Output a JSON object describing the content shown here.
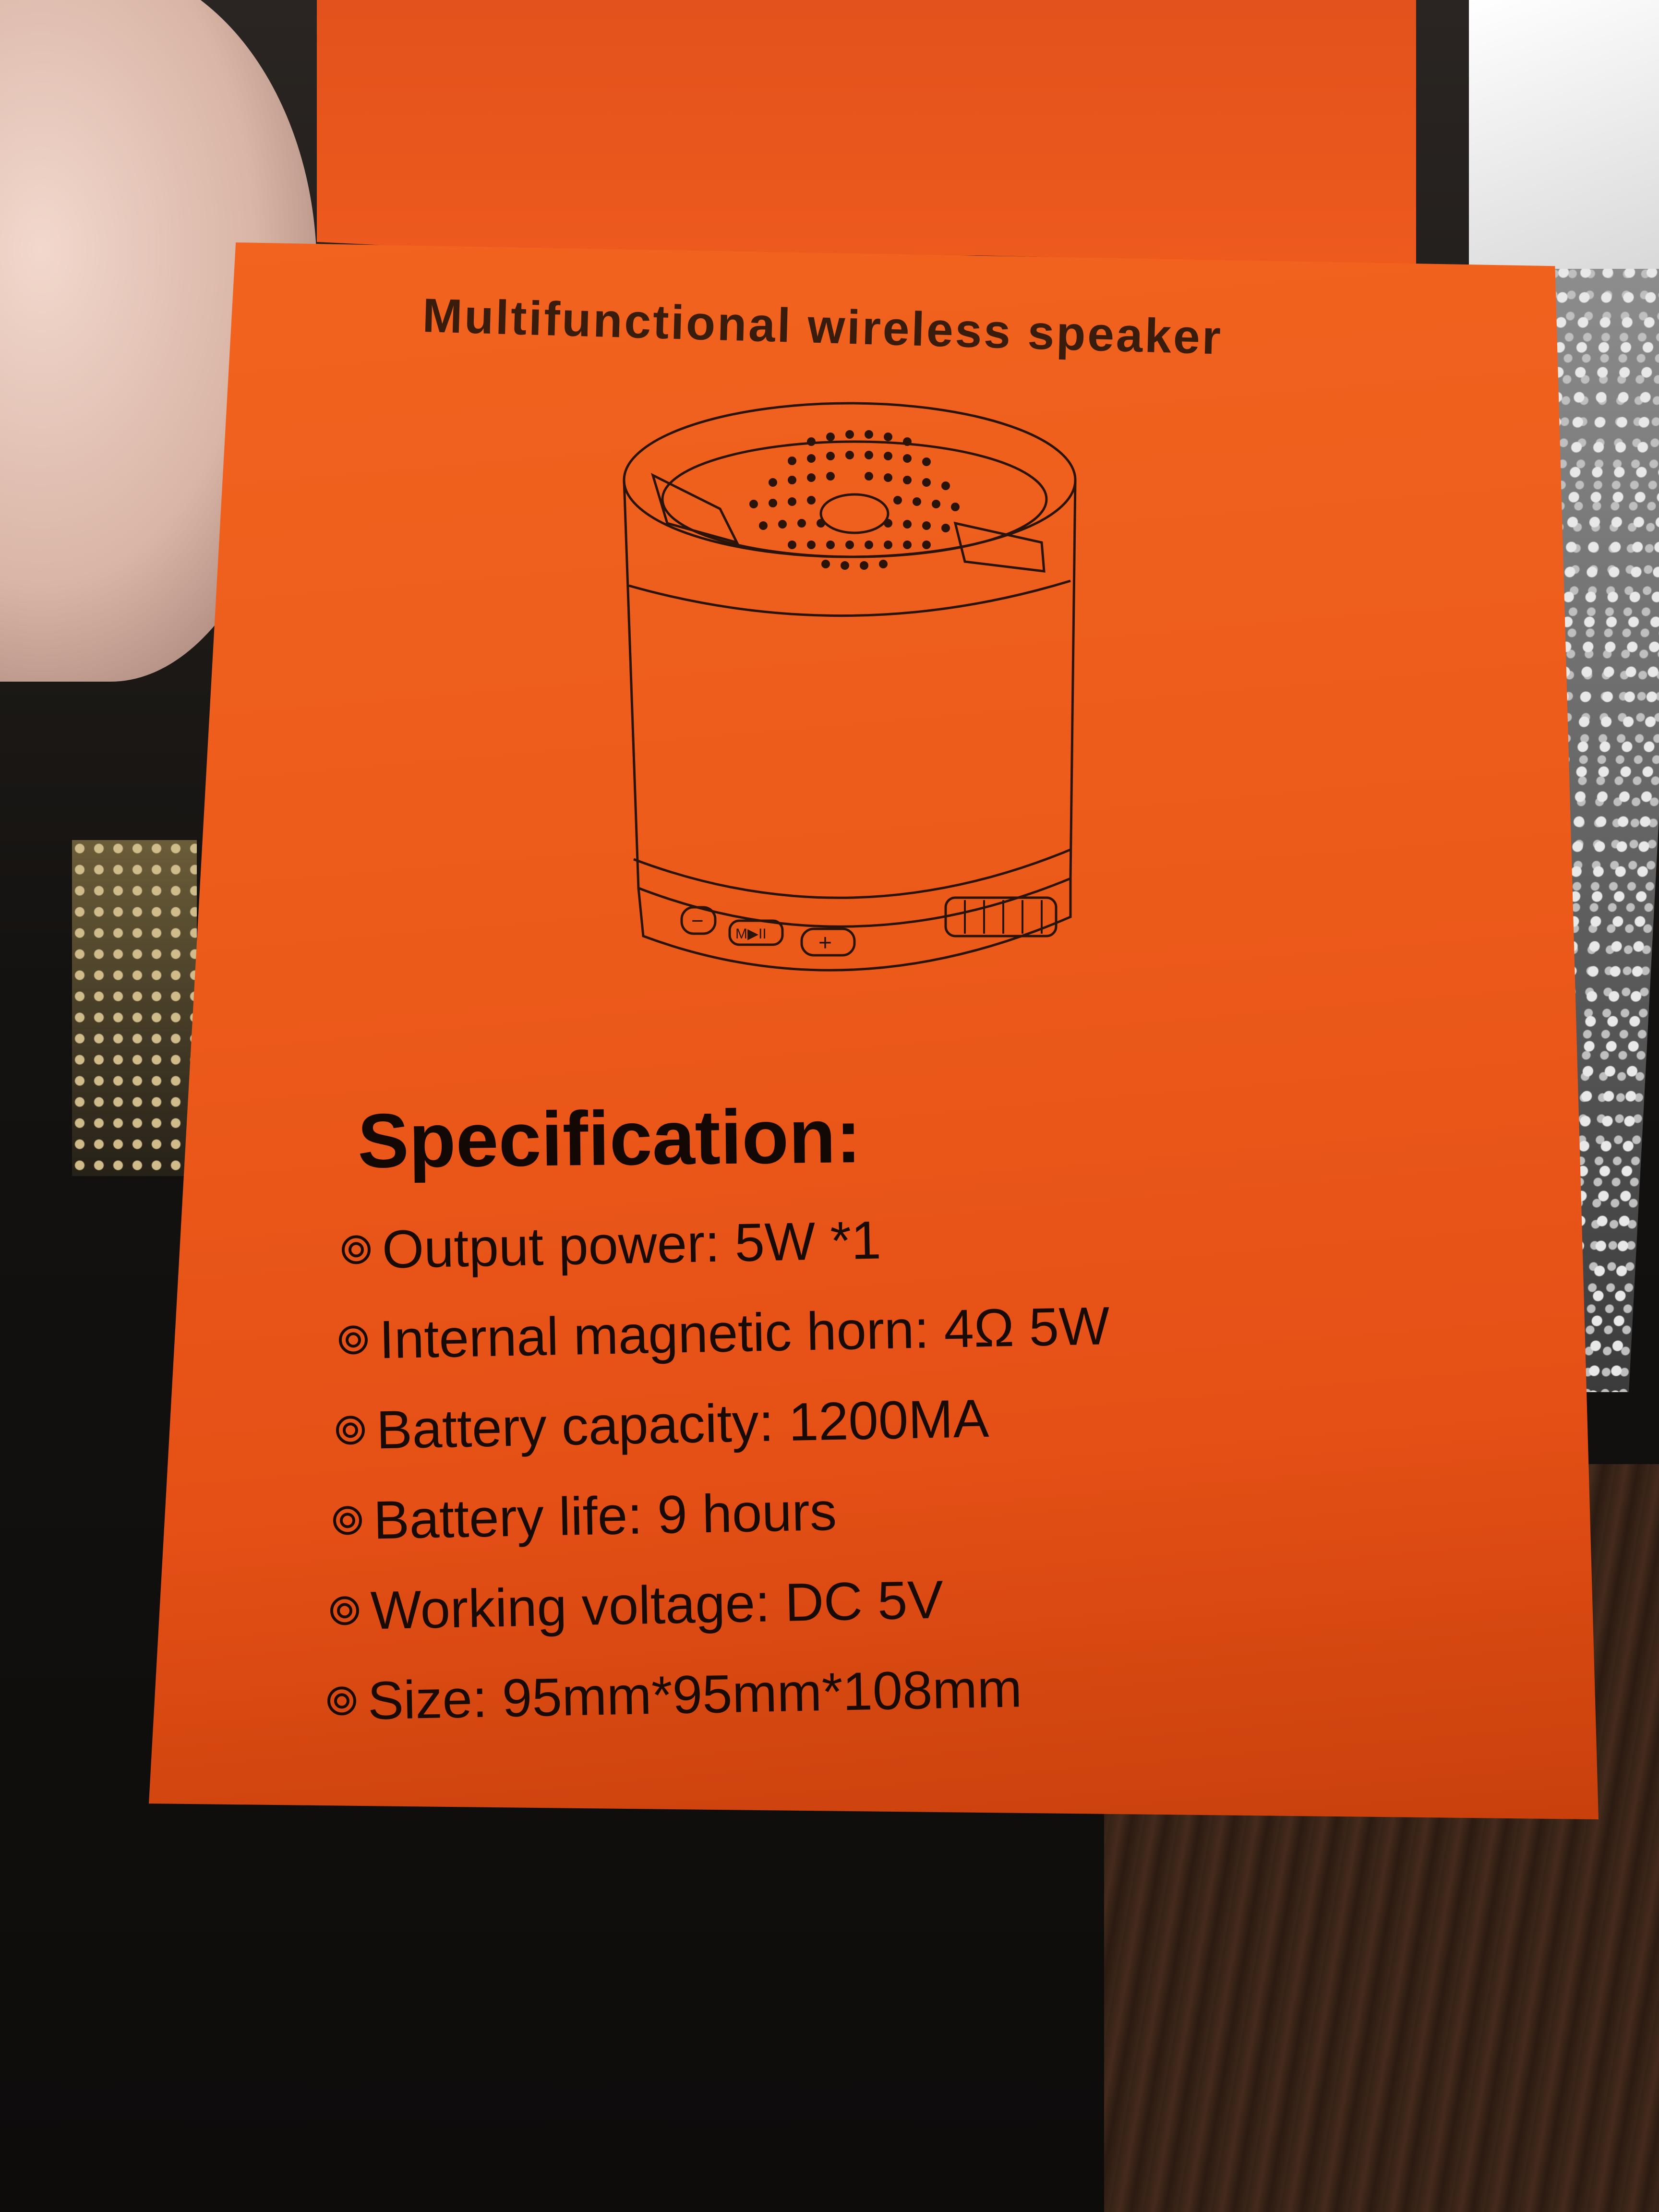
{
  "package": {
    "headline": "Multifunctional wireless speaker",
    "spec_title": "Specification:",
    "bullet_icon": "double-circle-bullet-icon",
    "specs": [
      "Output power: 5W *1",
      "Internal magnetic horn: 4Ω 5W",
      "Battery capacity: 1200MA",
      "Battery life: 9 hours",
      "Working voltage: DC 5V",
      "Size: 95mm*95mm*108mm"
    ],
    "illustration": {
      "play_button_label": "M▶II",
      "minus_button_label": "−",
      "plus_button_label": "+"
    },
    "colors": {
      "box_orange": "#ec5a1a",
      "ink": "#1a0a04"
    }
  }
}
